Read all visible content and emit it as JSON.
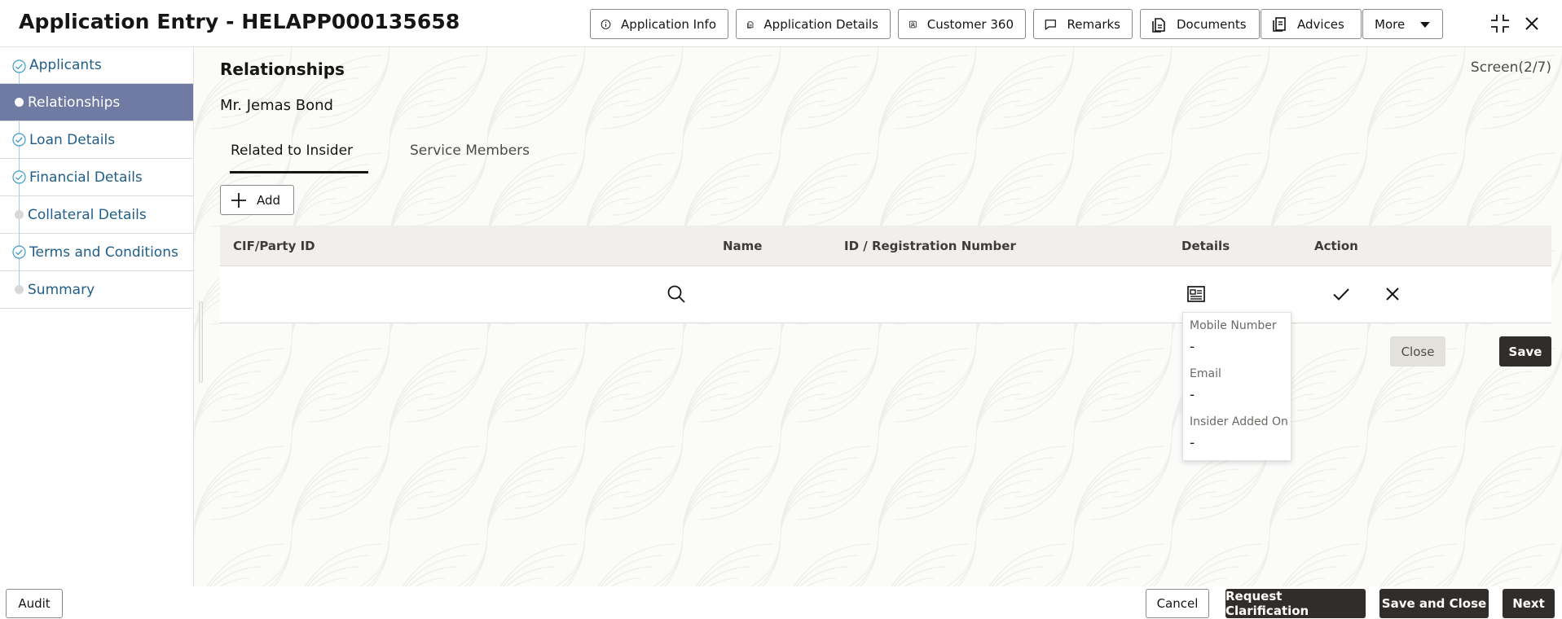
{
  "header": {
    "title": "Application Entry - HELAPP000135658",
    "buttons": [
      {
        "label": "Application Info",
        "icon": "info-icon"
      },
      {
        "label": "Application Details",
        "icon": "document-icon"
      },
      {
        "label": "Customer 360",
        "icon": "user-card-icon"
      },
      {
        "label": "Remarks",
        "icon": "comment-icon"
      },
      {
        "label": "Documents",
        "icon": "document-icon"
      },
      {
        "label": "Advices",
        "icon": "document-icon"
      },
      {
        "label": "More",
        "icon": "caret-down-icon"
      }
    ]
  },
  "sidebar": {
    "items": [
      {
        "label": "Applicants",
        "state": "completed"
      },
      {
        "label": "Relationships",
        "state": "active"
      },
      {
        "label": "Loan Details",
        "state": "completed"
      },
      {
        "label": "Financial Details",
        "state": "completed"
      },
      {
        "label": "Collateral Details",
        "state": "pending"
      },
      {
        "label": "Terms and Conditions",
        "state": "completed"
      },
      {
        "label": "Summary",
        "state": "pending"
      }
    ]
  },
  "main": {
    "title": "Relationships",
    "screen_counter": "Screen(2/7)",
    "applicant_name": "Mr. Jemas Bond",
    "tabs": [
      {
        "label": "Related to Insider",
        "active": true
      },
      {
        "label": "Service Members",
        "active": false
      }
    ],
    "add_label": "Add",
    "table": {
      "columns": [
        "CIF/Party ID",
        "Name",
        "ID / Registration Number",
        "Details",
        "Action"
      ]
    },
    "details_popup": {
      "mobile_label": "Mobile Number",
      "mobile_value": "-",
      "email_label": "Email",
      "email_value": "-",
      "insider_label": "Insider Added On",
      "insider_value": "-"
    },
    "close_label": "Close",
    "save_label": "Save"
  },
  "footer": {
    "audit_label": "Audit",
    "cancel_label": "Cancel",
    "request_clarification_label": "Request Clarification",
    "save_close_label": "Save and Close",
    "next_label": "Next"
  },
  "colors": {
    "accent_dark": "#312d2a",
    "sidebar_active": "#6f7ba2",
    "link": "#1f5e88"
  }
}
